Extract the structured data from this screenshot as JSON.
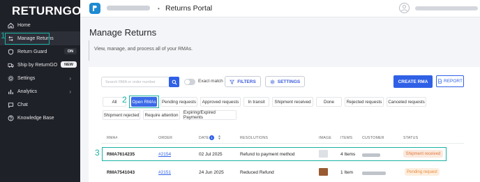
{
  "brand": "RETURNGO",
  "sidebar": {
    "items": [
      {
        "label": "Home",
        "icon": "home-icon"
      },
      {
        "label": "Manage Returns",
        "icon": "returns-icon"
      },
      {
        "label": "Return Guard",
        "icon": "shield-icon",
        "badge": "ON"
      },
      {
        "label": "Ship by ReturnGO",
        "icon": "truck-icon",
        "badge": "NEW"
      },
      {
        "label": "Settings",
        "icon": "gear-icon"
      },
      {
        "label": "Analytics",
        "icon": "chart-icon"
      },
      {
        "label": "Chat",
        "icon": "chat-icon"
      },
      {
        "label": "Knowledge Base",
        "icon": "help-icon"
      }
    ]
  },
  "annotations": [
    "1",
    "2",
    "3"
  ],
  "topbar": {
    "crumb_sep": "•",
    "title": "Returns Portal"
  },
  "page": {
    "title": "Manage Returns",
    "subtitle": "View, manage, and process all of your RMAs."
  },
  "toolbar": {
    "search_placeholder": "Search RMA or order number",
    "exact_match": "Exact match",
    "filters": "FILTERS",
    "settings": "SETTINGS",
    "create": "CREATE RMA",
    "report": "REPORT"
  },
  "tabs": [
    "All",
    "Open RMAs",
    "Pending requests",
    "Approved requests",
    "In transit",
    "Shipment received",
    "Done",
    "Rejected requests",
    "Canceled requests",
    "Shipment rejected",
    "Require attention",
    "Expiring/Expired Payments"
  ],
  "table": {
    "headers": [
      "RMA#",
      "ORDER",
      "DATE",
      "RESOLUTIONS",
      "IMAGE",
      "ITEMS",
      "CUSTOMER",
      "STATUS"
    ],
    "date_sort_badge": "1",
    "rows": [
      {
        "rma": "RMA7614235",
        "order": "#2154",
        "date": "02 Jul 2025",
        "resolution": "Refund to payment method",
        "items": "4 Items",
        "status": "Shipment received"
      },
      {
        "rma": "RMA7541043",
        "order": "#2151",
        "date": "24 Jun 2025",
        "resolution": "Reduced Refund",
        "items": "1 Item",
        "status": "Pending request"
      }
    ]
  },
  "colors": {
    "accent": "#2f60e6",
    "annotation": "#19b3a3",
    "sidebar": "#1f2128"
  }
}
